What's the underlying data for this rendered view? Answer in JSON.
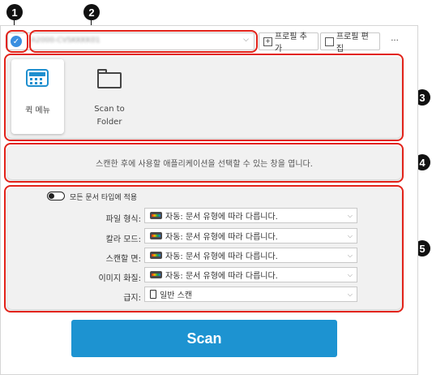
{
  "callouts": [
    "1",
    "2",
    "3",
    "4",
    "5"
  ],
  "header": {
    "profile_value": "A2000-CVSKKKK01",
    "add_profile_label": "프로필 추가",
    "edit_profile_label": "프로필 편집",
    "more_label": "···"
  },
  "apps": [
    {
      "label": "퀵 메뉴",
      "icon": "quick-menu-icon",
      "selected": true
    },
    {
      "label": "Scan to\nFolder",
      "icon": "folder-icon",
      "selected": false
    }
  ],
  "description": "스캔한 후에 사용할 애플리케이션을 선택할 수 있는 창을 엽니다.",
  "settings": {
    "apply_all_label": "모든 문서 타입에 적용",
    "rows": [
      {
        "label": "파일 형식:",
        "icon": "auto-icon",
        "value": "자동: 문서 유형에 따라 다릅니다."
      },
      {
        "label": "칼라 모드:",
        "icon": "auto-icon",
        "value": "자동: 문서 유형에 따라 다릅니다."
      },
      {
        "label": "스캔할 면:",
        "icon": "auto-icon",
        "value": "자동: 문서 유형에 따라 다릅니다."
      },
      {
        "label": "이미지 화질:",
        "icon": "auto-icon",
        "value": "자동: 문서 유형에 따라 다릅니다."
      },
      {
        "label": "급지:",
        "icon": "paper-feed-icon",
        "value": "일반 스캔"
      }
    ]
  },
  "scan_button_label": "Scan",
  "colors": {
    "accent": "#1f8fcf",
    "callout_frame": "#e2231a",
    "scan_button": "#1d93d1"
  }
}
